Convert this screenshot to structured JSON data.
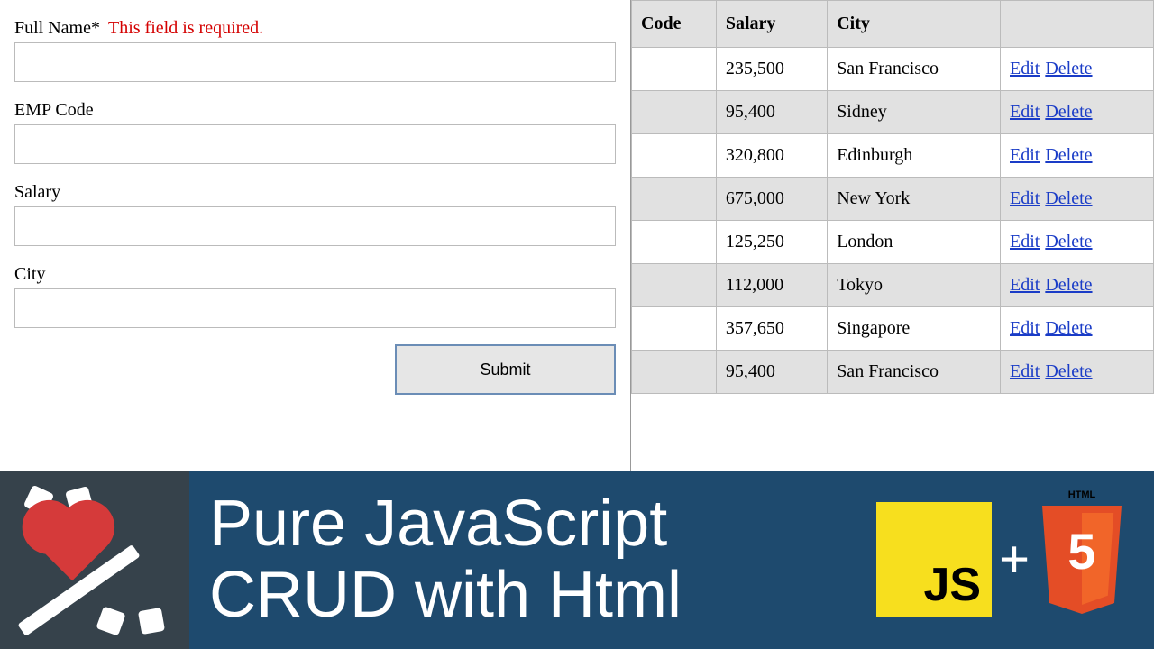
{
  "form": {
    "fields": [
      {
        "label": "Full Name",
        "required": true,
        "error": "This field is required."
      },
      {
        "label": "EMP Code",
        "required": false
      },
      {
        "label": "Salary",
        "required": false
      },
      {
        "label": "City",
        "required": false
      }
    ],
    "submit_label": "Submit"
  },
  "table": {
    "headers": [
      "Code",
      "Salary",
      "City"
    ],
    "actions": {
      "edit": "Edit",
      "delete": "Delete"
    },
    "rows": [
      {
        "salary": "235,500",
        "city": "San Francisco"
      },
      {
        "salary": "95,400",
        "city": "Sidney"
      },
      {
        "salary": "320,800",
        "city": "Edinburgh"
      },
      {
        "salary": "675,000",
        "city": "New York"
      },
      {
        "salary": "125,250",
        "city": "London"
      },
      {
        "salary": "112,000",
        "city": "Tokyo"
      },
      {
        "salary": "357,650",
        "city": "Singapore"
      },
      {
        "salary": "95,400",
        "city": "San Francisco"
      }
    ]
  },
  "banner": {
    "line1": "Pure JavaScript",
    "line2": "CRUD with Html",
    "js_label": "JS",
    "plus": "+",
    "html_top": "HTML",
    "html_five": "5"
  }
}
